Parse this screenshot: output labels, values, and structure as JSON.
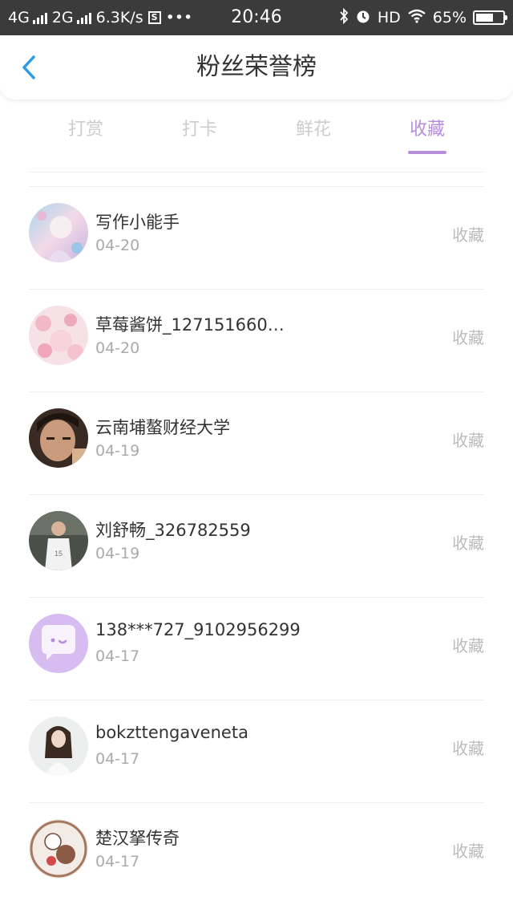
{
  "status_bar": {
    "network_1": "4G",
    "network_2": "2G",
    "speed": "6.3K/s",
    "time": "20:46",
    "hd": "HD",
    "battery": "65%",
    "battery_level": 0.65
  },
  "header": {
    "title": "粉丝荣誉榜"
  },
  "tabs": [
    {
      "label": "打赏",
      "active": false
    },
    {
      "label": "打卡",
      "active": false
    },
    {
      "label": "鲜花",
      "active": false
    },
    {
      "label": "收藏",
      "active": true
    }
  ],
  "list": {
    "items": [
      {
        "name": "写作小能手",
        "date": "04-20",
        "action": "收藏",
        "avatar": "anime-pastel"
      },
      {
        "name": "草莓酱饼_127151660…",
        "date": "04-20",
        "action": "收藏",
        "avatar": "pink-floral"
      },
      {
        "name": "云南埔螯财经大学",
        "date": "04-19",
        "action": "收藏",
        "avatar": "portrait-dark"
      },
      {
        "name": "刘舒畅_326782559",
        "date": "04-19",
        "action": "收藏",
        "avatar": "basketball-player"
      },
      {
        "name": "138***727_9102956299",
        "date": "04-17",
        "action": "收藏",
        "avatar": "default-chat"
      },
      {
        "name": "bokzttengaveneta",
        "date": "04-17",
        "action": "收藏",
        "avatar": "girl-light"
      },
      {
        "name": "楚汉拏传奇",
        "date": "04-17",
        "action": "收藏",
        "avatar": "cartoon-brown"
      }
    ]
  },
  "colors": {
    "accent": "#b68ddb",
    "back_arrow": "#2b9be6",
    "status_bar_bg": "#3b3b3b"
  }
}
